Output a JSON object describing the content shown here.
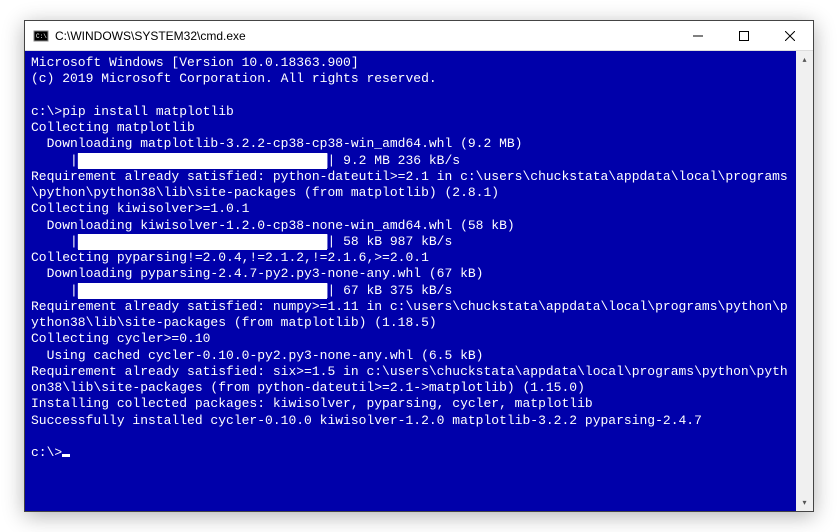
{
  "window": {
    "title": "C:\\WINDOWS\\SYSTEM32\\cmd.exe"
  },
  "terminal": {
    "header_line1": "Microsoft Windows [Version 10.0.18363.900]",
    "header_line2": "(c) 2019 Microsoft Corporation. All rights reserved.",
    "prompt1": "c:\\>",
    "command1": "pip install matplotlib",
    "collect_matplotlib": "Collecting matplotlib",
    "dl_matplotlib": "  Downloading matplotlib-3.2.2-cp38-cp38-win_amd64.whl (9.2 MB)",
    "pb1_prefix": "     |",
    "pb1_fill": "████████████████████████████████",
    "pb1_suffix": "| 9.2 MB 236 kB/s",
    "req_dateutil": "Requirement already satisfied: python-dateutil>=2.1 in c:\\users\\chuckstata\\appdata\\local\\programs\\python\\python38\\lib\\site-packages (from matplotlib) (2.8.1)",
    "collect_kiwi": "Collecting kiwisolver>=1.0.1",
    "dl_kiwi": "  Downloading kiwisolver-1.2.0-cp38-none-win_amd64.whl (58 kB)",
    "pb2_prefix": "     |",
    "pb2_fill": "████████████████████████████████",
    "pb2_suffix": "| 58 kB 987 kB/s",
    "collect_pyparsing": "Collecting pyparsing!=2.0.4,!=2.1.2,!=2.1.6,>=2.0.1",
    "dl_pyparsing": "  Downloading pyparsing-2.4.7-py2.py3-none-any.whl (67 kB)",
    "pb3_prefix": "     |",
    "pb3_fill": "████████████████████████████████",
    "pb3_suffix": "| 67 kB 375 kB/s",
    "req_numpy": "Requirement already satisfied: numpy>=1.11 in c:\\users\\chuckstata\\appdata\\local\\programs\\python\\python38\\lib\\site-packages (from matplotlib) (1.18.5)",
    "collect_cycler": "Collecting cycler>=0.10",
    "cached_cycler": "  Using cached cycler-0.10.0-py2.py3-none-any.whl (6.5 kB)",
    "req_six": "Requirement already satisfied: six>=1.5 in c:\\users\\chuckstata\\appdata\\local\\programs\\python\\python38\\lib\\site-packages (from python-dateutil>=2.1->matplotlib) (1.15.0)",
    "installing": "Installing collected packages: kiwisolver, pyparsing, cycler, matplotlib",
    "success": "Successfully installed cycler-0.10.0 kiwisolver-1.2.0 matplotlib-3.2.2 pyparsing-2.4.7",
    "prompt2": "c:\\>"
  }
}
